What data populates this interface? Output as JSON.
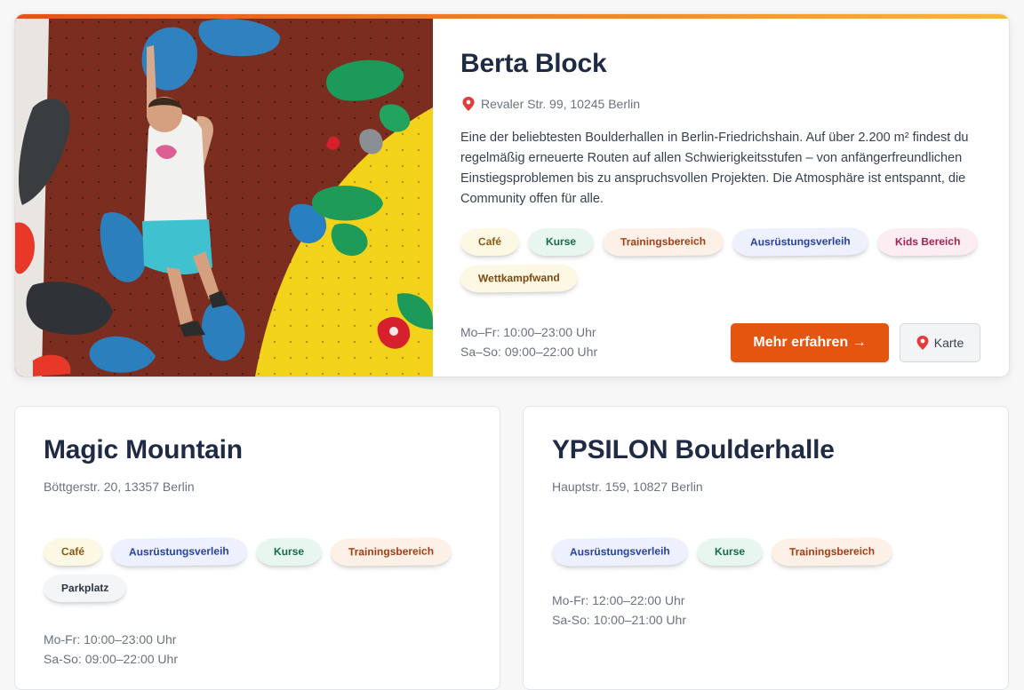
{
  "featured": {
    "name": "Berta Block",
    "address": "Revaler Str. 99, 10245 Berlin",
    "description": "Eine der beliebtesten Boulderhallen in Berlin-Friedrichshain. Auf über 2.200 m² findest du regelmäßig erneuerte Routen auf allen Schwierigkeitsstufen – von anfängerfreundlichen Einstiegsproblemen bis zu anspruchsvollen Projekten. Die Atmosphäre ist entspannt, die Community offen für alle.",
    "tags": [
      "Café",
      "Kurse",
      "Trainingsbereich",
      "Ausrüstungsverleih",
      "Kids Bereich",
      "Wettkampfwand"
    ],
    "hours": [
      "Mo–Fr: 10:00–23:00 Uhr",
      "Sa–So: 09:00–22:00 Uhr"
    ],
    "cta_label": "Mehr erfahren →",
    "map_label": "Karte",
    "photo_icon": "climber-photo",
    "accent_color": "#e6550f"
  },
  "gyms": [
    {
      "name": "Magic Mountain",
      "address": "Böttgerstr. 20, 13357 Berlin",
      "tags": [
        "Café",
        "Ausrüstungsverleih",
        "Kurse",
        "Trainingsbereich",
        "Parkplatz"
      ],
      "hours": [
        "Mo-Fr: 10:00–23:00 Uhr",
        "Sa-So: 09:00–22:00 Uhr"
      ]
    },
    {
      "name": "YPSILON Boulderhalle",
      "address": "Hauptstr. 159, 10827 Berlin",
      "tags": [
        "Ausrüstungsverleih",
        "Kurse",
        "Trainingsbereich"
      ],
      "hours": [
        "Mo-Fr: 12:00–22:00 Uhr",
        "Sa-So: 10:00–21:00 Uhr"
      ]
    }
  ]
}
